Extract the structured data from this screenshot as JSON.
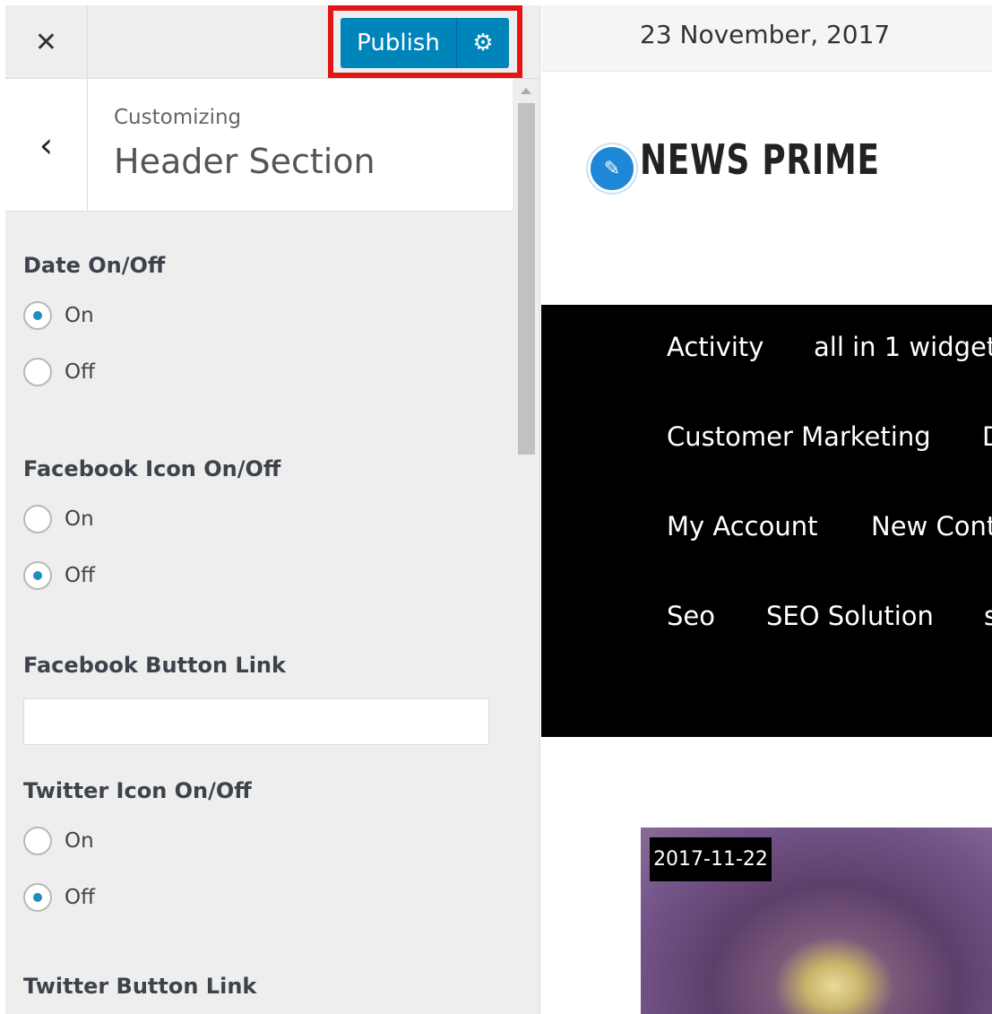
{
  "customizer": {
    "close_icon": "close-icon",
    "publish_label": "Publish",
    "settings_icon": "gear-icon",
    "back_icon": "chevron-left-icon",
    "breadcrumb": "Customizing",
    "section_title": "Header Section",
    "accent_color": "#0085ba",
    "highlight_color": "#e31515"
  },
  "controls": {
    "date": {
      "title": "Date On/Off",
      "options": [
        "On",
        "Off"
      ],
      "selected": "On"
    },
    "facebook_icon": {
      "title": "Facebook Icon On/Off",
      "options": [
        "On",
        "Off"
      ],
      "selected": "Off"
    },
    "facebook_link": {
      "title": "Facebook Button Link",
      "value": ""
    },
    "twitter_icon": {
      "title": "Twitter Icon On/Off",
      "options": [
        "On",
        "Off"
      ],
      "selected": "Off"
    },
    "twitter_link": {
      "title": "Twitter Button Link"
    }
  },
  "preview": {
    "date": "23 November, 2017",
    "logo_icon": "pencil-icon",
    "logo_text": "NEWS PRIME",
    "nav_items": [
      "Activity",
      "all in 1 widget",
      "Customer Marketing",
      "D",
      "My Account",
      "New Cont",
      "Seo",
      "SEO Solution",
      "s"
    ],
    "post_date": "2017-11-22"
  }
}
